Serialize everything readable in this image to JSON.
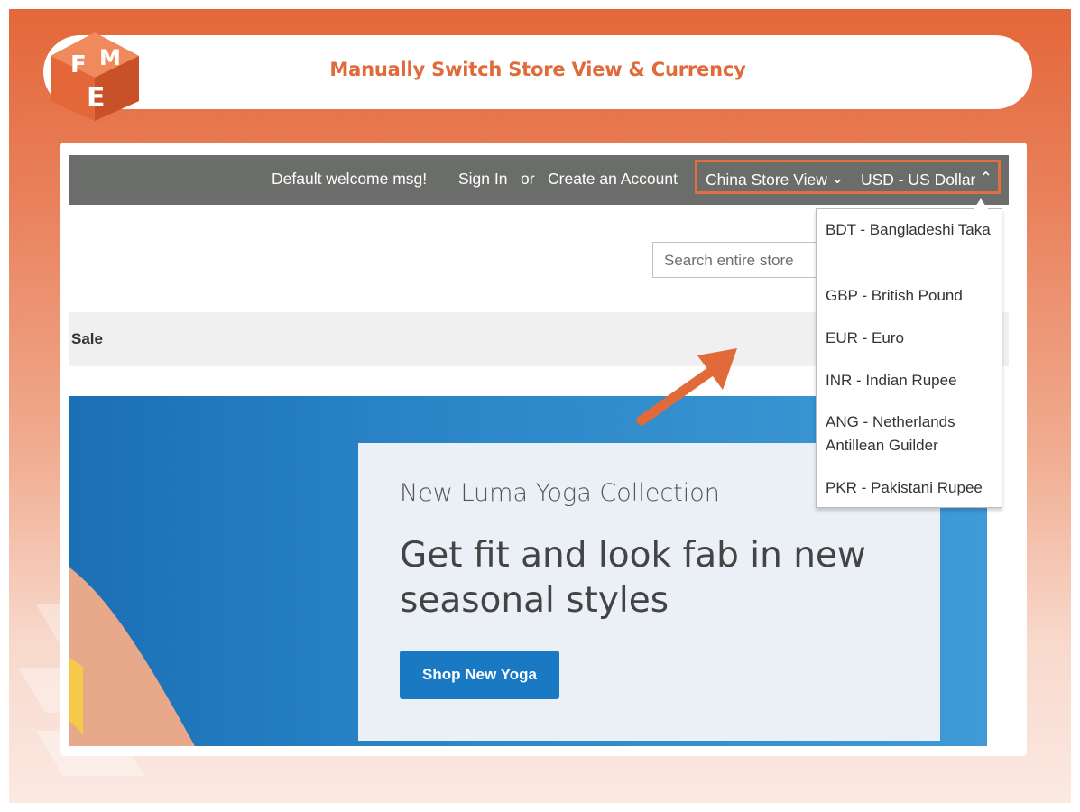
{
  "title": "Manually Switch Store View & Currency",
  "logo": {
    "text": "FME",
    "letters": [
      "F",
      "M",
      "E"
    ]
  },
  "header": {
    "welcome": "Default welcome msg!",
    "sign_in": "Sign In",
    "or": "or",
    "create_account": "Create an Account",
    "store_view": "China Store View",
    "currency": "USD - US Dollar"
  },
  "search": {
    "placeholder": "Search entire store"
  },
  "nav": {
    "sale": "Sale"
  },
  "currency_options": [
    "BDT - Bangladeshi Taka",
    "GBP - British Pound",
    "EUR - Euro",
    "INR - Indian Rupee",
    "ANG - Netherlands Antillean Guilder",
    "PKR - Pakistani Rupee"
  ],
  "hero": {
    "subtitle": "New Luma Yoga Collection",
    "headline": "Get fit and look fab in new seasonal styles",
    "button": "Shop New Yoga"
  },
  "colors": {
    "accent": "#e06a3a",
    "header_bar": "#6b6d6a",
    "hero_blue": "#2b86c8",
    "button_blue": "#1979c3"
  },
  "icons": [
    "chevron-down-icon",
    "chevron-up-icon",
    "pointer-arrow-icon"
  ]
}
